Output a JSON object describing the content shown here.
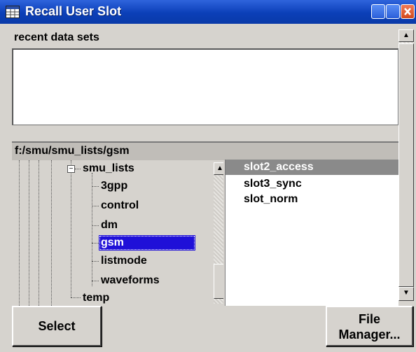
{
  "window": {
    "title": "Recall User Slot",
    "title_icon": "table-window-icon",
    "controls": [
      "minimize-icon",
      "maximize-icon",
      "close-icon"
    ]
  },
  "recent": {
    "label": "recent data sets",
    "items": []
  },
  "browser": {
    "path": "f:/smu/smu_lists/gsm",
    "tree": [
      {
        "label": "smu_lists",
        "level": 0,
        "expanded": true
      },
      {
        "label": "3gpp",
        "level": 1
      },
      {
        "label": "control",
        "level": 1
      },
      {
        "label": "dm",
        "level": 1
      },
      {
        "label": "gsm",
        "level": 1,
        "selected": true
      },
      {
        "label": "listmode",
        "level": 1
      },
      {
        "label": "waveforms",
        "level": 1
      },
      {
        "label": "temp",
        "level": 0
      }
    ],
    "files": [
      {
        "label": "slot2_access",
        "selected": true
      },
      {
        "label": "slot3_sync"
      },
      {
        "label": "slot_norm"
      }
    ]
  },
  "buttons": {
    "select": "Select",
    "file_manager_line1": "File",
    "file_manager_line2": "Manager..."
  },
  "colors": {
    "titlebar": "#0b3fb8",
    "dialog_bg": "#d6d3ce",
    "tree_selection": "#1f10d8",
    "file_selection": "#8a8a8a"
  }
}
